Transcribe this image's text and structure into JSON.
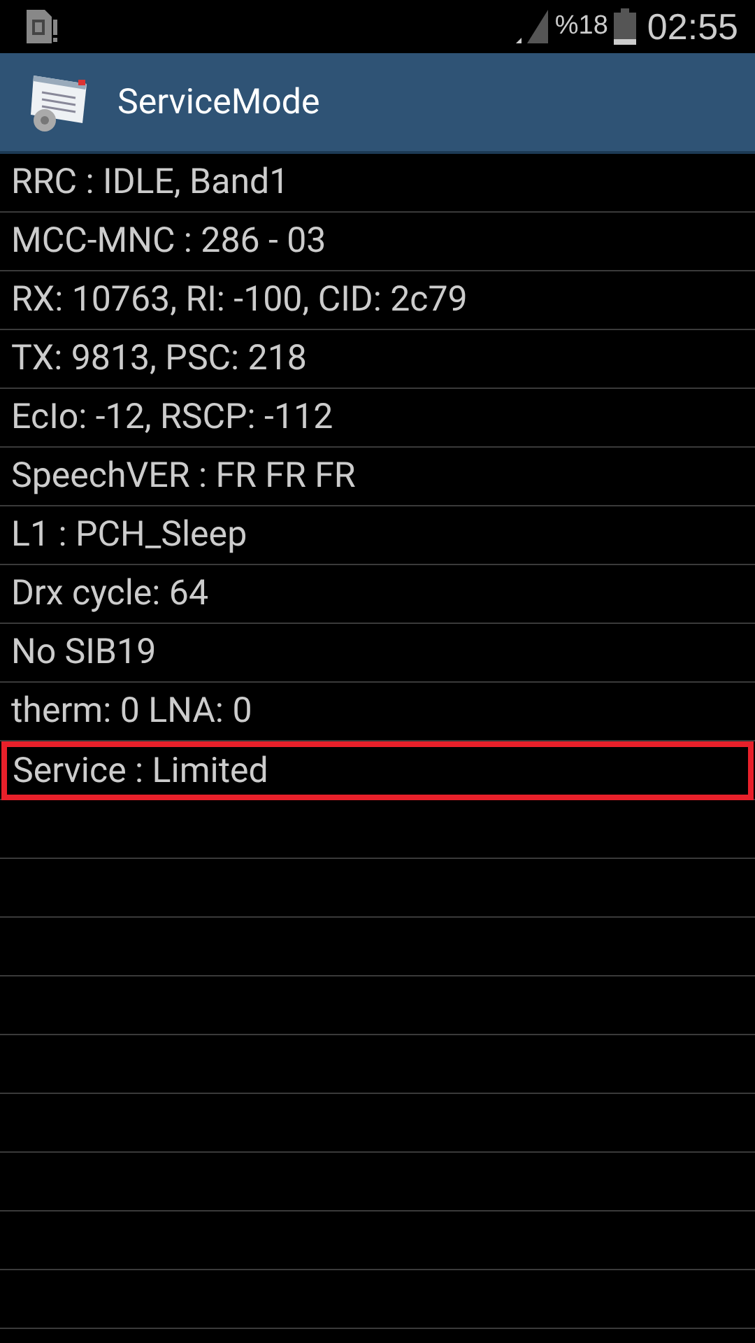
{
  "status_bar": {
    "battery_text": "%18",
    "time": "02:55"
  },
  "app_bar": {
    "title": "ServiceMode"
  },
  "rows": [
    {
      "text": "RRC : IDLE, Band1",
      "highlighted": false
    },
    {
      "text": "MCC-MNC : 286 - 03",
      "highlighted": false
    },
    {
      "text": "RX: 10763, RI: -100, CID: 2c79",
      "highlighted": false
    },
    {
      "text": "TX: 9813, PSC: 218",
      "highlighted": false
    },
    {
      "text": "EcIo: -12, RSCP: -112",
      "highlighted": false
    },
    {
      "text": "SpeechVER : FR FR FR",
      "highlighted": false
    },
    {
      "text": "L1 : PCH_Sleep",
      "highlighted": false
    },
    {
      "text": "Drx cycle: 64",
      "highlighted": false
    },
    {
      "text": "No SIB19",
      "highlighted": false
    },
    {
      "text": "therm: 0 LNA: 0",
      "highlighted": false
    },
    {
      "text": "Service : Limited",
      "highlighted": true
    }
  ]
}
